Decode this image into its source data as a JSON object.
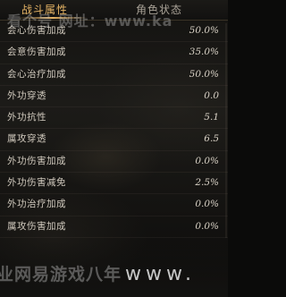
{
  "tabs": {
    "active": "战斗属性",
    "inactive": "角色状态"
  },
  "stats": [
    {
      "label": "会心伤害加成",
      "value": "50.0%"
    },
    {
      "label": "会意伤害加成",
      "value": "35.0%"
    },
    {
      "label": "会心治疗加成",
      "value": "50.0%"
    },
    {
      "label": "外功穿透",
      "value": "0.0"
    },
    {
      "label": "外功抗性",
      "value": "5.1"
    },
    {
      "label": "属攻穿透",
      "value": "6.5"
    },
    {
      "label": "外功伤害加成",
      "value": "0.0%"
    },
    {
      "label": "外功伤害减免",
      "value": "2.5%"
    },
    {
      "label": "外功治疗加成",
      "value": "0.0%"
    },
    {
      "label": "属攻伤害加成",
      "value": "0.0%"
    }
  ],
  "watermarks": {
    "top": "看个号  网址：www.ka",
    "bottom": "业网易游戏八年",
    "bottom_url": "www."
  }
}
